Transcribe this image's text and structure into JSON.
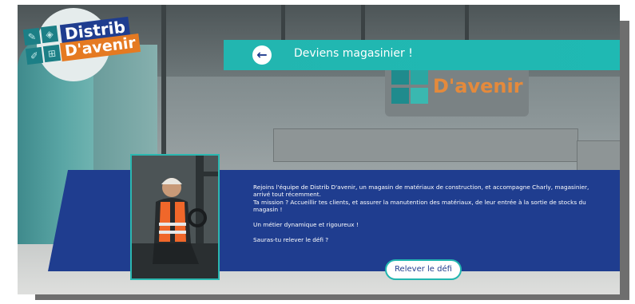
{
  "logo": {
    "line1": "Distrib",
    "line2": "D'avenir",
    "icons": [
      "ruler-icon",
      "trowel-icon",
      "pencil-icon",
      "grid-icon"
    ]
  },
  "header": {
    "back_icon": "arrow-left-icon",
    "title": "Deviens magasinier !"
  },
  "background": {
    "sign_text": "D'avenir"
  },
  "panel": {
    "paragraph1": "Rejoins l'équipe de Distrib D'avenir, un magasin de matériaux de construction, et accompagne Charly, magasinier, arrivé tout récemment.",
    "paragraph2": "Ta mission ? Accueillir tes clients, et assurer la manutention des matériaux, de leur entrée à la sortie de stocks du magasin !",
    "paragraph3": "Un métier dynamique et rigoureux !",
    "paragraph4": "Sauras-tu relever le défi ?"
  },
  "cta": {
    "label": "Relever le défi"
  },
  "colors": {
    "navy": "#1f3d8f",
    "teal": "#22b6b0",
    "orange": "#e57a22"
  }
}
